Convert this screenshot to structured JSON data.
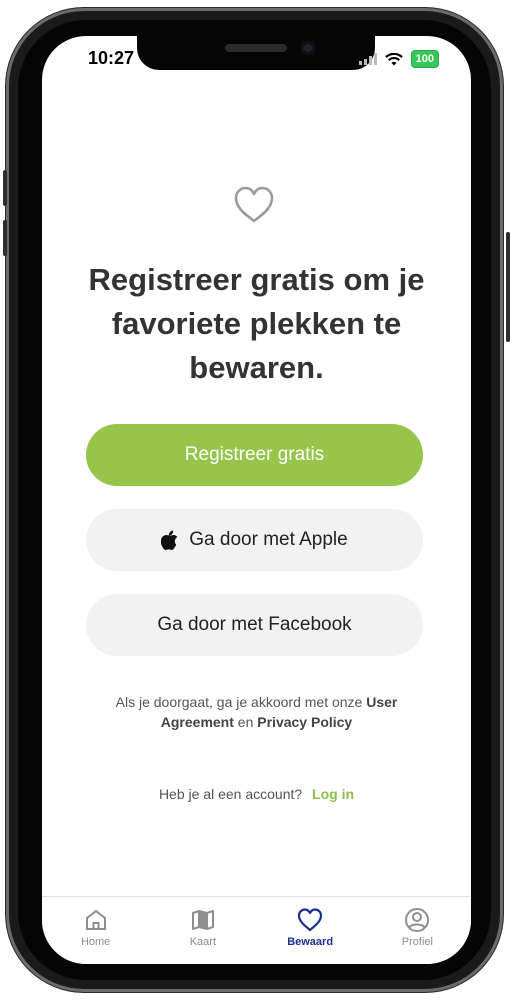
{
  "status_bar": {
    "time": "10:27",
    "battery": "100"
  },
  "main": {
    "headline": "Registreer gratis om je favoriete plekken te bewaren.",
    "register_button": "Registreer gratis",
    "apple_button": "Ga door met Apple",
    "facebook_button": "Ga door met Facebook",
    "legal": {
      "prefix": "Als je doorgaat, ga je akkoord met onze",
      "user_agreement": "User Agreement",
      "and": "en",
      "privacy_policy": "Privacy Policy"
    },
    "login_prompt": "Heb je al een account?",
    "login_link": "Log in"
  },
  "tabbar": {
    "tabs": [
      {
        "label": "Home",
        "icon": "home-icon"
      },
      {
        "label": "Kaart",
        "icon": "map-icon"
      },
      {
        "label": "Bewaard",
        "icon": "heart-icon",
        "active": true
      },
      {
        "label": "Profiel",
        "icon": "profile-icon"
      }
    ]
  },
  "colors": {
    "accent_green": "#97c54a",
    "login_green": "#8cc04a",
    "active_tab": "#1b2f8c",
    "secondary_button": "#f2f2f2"
  }
}
